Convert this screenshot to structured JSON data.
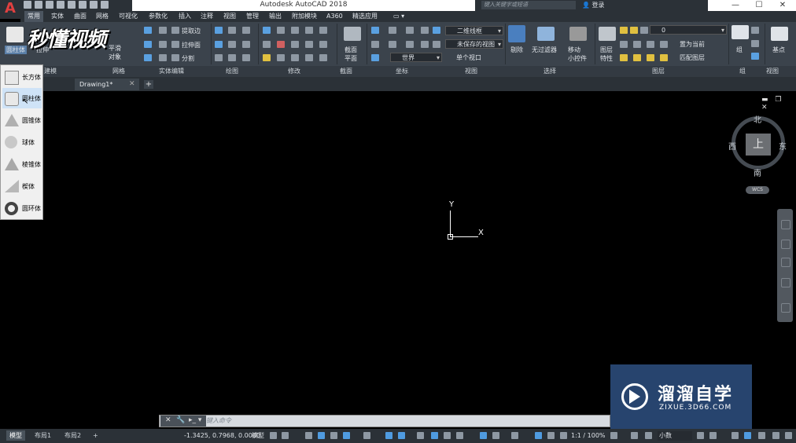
{
  "app": {
    "title": "Autodesk AutoCAD 2018",
    "logo_letter": "A",
    "search_placeholder": "键入关键字或短语",
    "login_label": "登录",
    "window_controls": {
      "minimize": "—",
      "restore": "☐",
      "close": "✕"
    }
  },
  "menu_tabs": [
    "常用",
    "实体",
    "曲面",
    "网格",
    "可视化",
    "参数化",
    "插入",
    "注释",
    "视图",
    "管理",
    "输出",
    "附加模块",
    "A360",
    "精选应用"
  ],
  "active_menu_tab": "常用",
  "ribbon": {
    "primitive_split_button": "圆柱体",
    "extrude_label": "拉伸",
    "smooth_object_label": "平滑\n对象",
    "extract_edges": "提取边",
    "extrude_face": "拉伸面",
    "split": "分割",
    "section_plane": "截面\n平面",
    "visual_style": "二维线框",
    "named_view": "未保存的视图",
    "ucs": "世界",
    "single_viewport": "单个视口",
    "culling": "剔除",
    "no_filter": "无过滤器",
    "move_gizmo": "移动\n小控件",
    "layer_properties": "图层\n特性",
    "layer_name": "0",
    "set_current": "置为当前",
    "match_layer": "匹配图层",
    "group": "组",
    "base_point": "基点"
  },
  "panel_labels": [
    "建模",
    "网格",
    "实体编辑",
    "绘图",
    "修改",
    "截面",
    "坐标",
    "视图",
    "选择",
    "图层",
    "组",
    "视图"
  ],
  "watermark_top": "秒懂视频",
  "file_tabs": {
    "document": "Drawing1*",
    "add": "+"
  },
  "primitive_menu": {
    "items": [
      "长方体",
      "圆柱体",
      "圆锥体",
      "球体",
      "棱锥体",
      "楔体",
      "圆环体"
    ],
    "selected_index": 1
  },
  "viewcube": {
    "north": "北",
    "south": "南",
    "east": "东",
    "west": "西",
    "face": "上",
    "wcs": "WCS"
  },
  "ucs_icon": {
    "x_label": "X",
    "y_label": "Y"
  },
  "command_line": {
    "prompt": "键入命令"
  },
  "watermark_brand": {
    "title": "溜溜自学",
    "url": "ZIXUE.3D66.COM"
  },
  "status": {
    "layout_tabs": [
      "模型",
      "布局1",
      "布局2"
    ],
    "add_layout": "+",
    "coordinates": "-1.3425, 0.7968, 0.0000",
    "model_label": "模型",
    "scale": "1:1 / 100%",
    "units": "小数"
  },
  "colors": {
    "canvas": "#000000",
    "ribbon": "#3b434c",
    "dark": "#2b3137",
    "accent": "#4f9be0",
    "brand_blue": "#27446e"
  }
}
